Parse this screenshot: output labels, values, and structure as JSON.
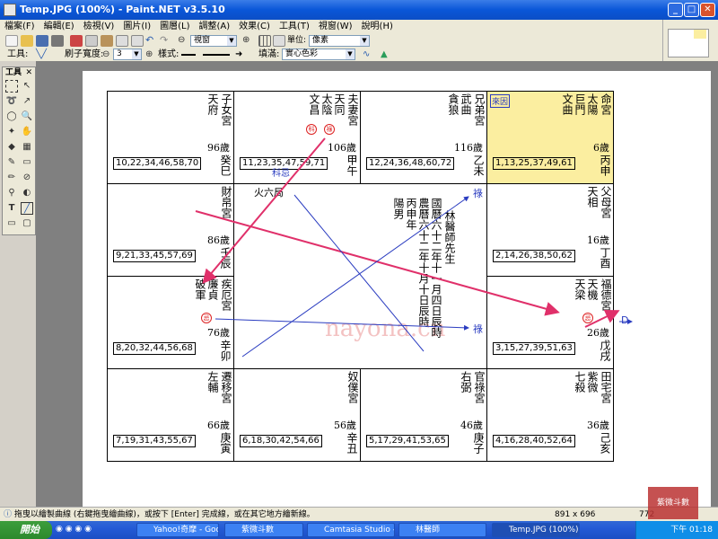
{
  "window": {
    "title": "Temp.JPG (100%) - Paint.NET v3.5.10",
    "min": "_",
    "max": "□",
    "close": "✕"
  },
  "menu": [
    "檔案(F)",
    "編輯(E)",
    "檢視(V)",
    "圖片(I)",
    "圖層(L)",
    "調整(A)",
    "效果(C)",
    "工具(T)",
    "視窗(W)",
    "說明(H)"
  ],
  "toolbar": {
    "zoom_value": "視窗",
    "units_label": "單位:",
    "units_value": "像素"
  },
  "toolbar2": {
    "tool_label": "工具:",
    "brush_label": "刷子寬度:",
    "brush_value": "3",
    "style_label": "樣式:",
    "fill_label": "填滿:",
    "fill_value": "實心色彩"
  },
  "tools_panel": {
    "title": "工具",
    "close": "✕"
  },
  "chart": {
    "cells": [
      {
        "id": "si",
        "stars": [
          "天府"
        ],
        "palace": "子女宮",
        "age": "96歲",
        "gz": "癸巳",
        "nums": "10,22,34,46,58,70"
      },
      {
        "id": "wu",
        "stars": [
          "天同",
          "太陰",
          "文昌"
        ],
        "palace": "夫妻宮",
        "age": "106歲",
        "gz": "甲午",
        "nums": "11,23,35,47,59,71",
        "hua": [
          "科",
          "祿"
        ]
      },
      {
        "id": "wei",
        "stars": [
          "武曲",
          "貪狼"
        ],
        "palace": "兄弟宮",
        "age": "116歲",
        "gz": "乙未",
        "nums": "12,24,36,48,60,72"
      },
      {
        "id": "shen",
        "stars": [
          "太陽",
          "巨門",
          "文曲"
        ],
        "palace": "命宮",
        "age": "6歲",
        "gz": "丙申",
        "nums": "1,13,25,37,49,61",
        "tag": "來因"
      },
      {
        "id": "chen",
        "stars": [],
        "palace": "財帛宮",
        "age": "86歲",
        "gz": "壬辰",
        "nums": "9,21,33,45,57,69"
      },
      {
        "id": "you",
        "stars": [
          "天相"
        ],
        "palace": "父母宮",
        "age": "16歲",
        "gz": "丁酉",
        "nums": "2,14,26,38,50,62"
      },
      {
        "id": "mao",
        "stars": [
          "廉貞",
          "破軍"
        ],
        "palace": "疾厄宮",
        "age": "76歲",
        "gz": "辛卯",
        "nums": "8,20,32,44,56,68",
        "hua": [
          "忌"
        ]
      },
      {
        "id": "xu",
        "stars": [
          "天機",
          "天梁"
        ],
        "palace": "福德宮",
        "age": "26歲",
        "gz": "戊戌",
        "nums": "3,15,27,39,51,63",
        "hua": [
          "忌"
        ]
      },
      {
        "id": "yin",
        "stars": [
          "左輔"
        ],
        "palace": "遷移宮",
        "age": "66歲",
        "gz": "庚寅",
        "nums": "7,19,31,43,55,67"
      },
      {
        "id": "chou",
        "stars": [],
        "palace": "奴僕宮",
        "age": "56歲",
        "gz": "辛丑",
        "nums": "6,18,30,42,54,66"
      },
      {
        "id": "zi",
        "stars": [
          "右弼"
        ],
        "palace": "官祿宮",
        "age": "46歲",
        "gz": "庚子",
        "nums": "5,17,29,41,53,65"
      },
      {
        "id": "hai",
        "stars": [
          "紫微",
          "七殺"
        ],
        "palace": "田宅宮",
        "age": "36歲",
        "gz": "己亥",
        "nums": "4,16,28,40,52,64"
      }
    ],
    "center": {
      "name": "林醫師先生",
      "l1": "國曆六十二年十一月四日辰時",
      "l2": "農曆六十二年十月十日辰時",
      "l3": "陽男",
      "l4": "丙申年"
    },
    "annotations": {
      "wuxing": "火六局",
      "ke_ji": "科忌",
      "lu_top": "祿",
      "lu_bottom": "祿",
      "d": "D"
    },
    "watermark": "nayona.cn"
  },
  "status": {
    "text": "拖曳以繪製曲線 (右鍵拖曳繪曲線)，或按下 [Enter] 完成線，或在其它地方繪新線。",
    "size": "891 x 696",
    "coord": "772"
  },
  "taskbar": {
    "start": "開始",
    "tasks": [
      "Yahoo!奇摩 - Goo...",
      "紫微斗數",
      "Camtasia Studio - ...",
      "林醫師",
      "Temp.JPG (100%)..."
    ],
    "clock": "下午 01:18"
  },
  "stamp_text": "紫微斗數"
}
